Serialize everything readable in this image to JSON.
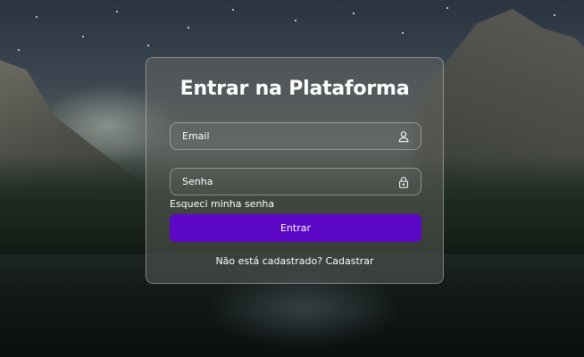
{
  "login": {
    "title": "Entrar na Plataforma",
    "email": {
      "placeholder": "Email",
      "value": "",
      "icon": "user-icon"
    },
    "password": {
      "placeholder": "Senha",
      "value": "",
      "icon": "lock-icon"
    },
    "forgot_label": "Esqueci minha senha",
    "submit_label": "Entrar",
    "register_prompt": "Não está cadastrado?",
    "register_link": "Cadastrar"
  },
  "colors": {
    "accent": "#5c08c6",
    "text": "#ffffff"
  }
}
